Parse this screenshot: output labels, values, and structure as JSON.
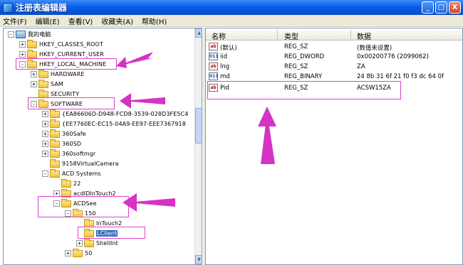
{
  "window": {
    "title": "注册表编辑器",
    "minimize_glyph": "_",
    "maximize_glyph": "□",
    "close_glyph": "X"
  },
  "menu": [
    "文件(F)",
    "编辑(E)",
    "查看(V)",
    "收藏夹(A)",
    "帮助(H)"
  ],
  "tree": [
    {
      "label": "我的电脑",
      "expander": "-",
      "icon": "computer-icon"
    },
    {
      "label": "HKEY_CLASSES_ROOT",
      "expander": "+",
      "icon": "folder-icon"
    },
    {
      "label": "HKEY_CURRENT_USER",
      "expander": "+",
      "icon": "folder-icon"
    },
    {
      "label": "HKEY_LOCAL_MACHINE",
      "expander": "-",
      "icon": "folder-icon"
    },
    {
      "label": "HARDWARE",
      "expander": "+",
      "icon": "folder-icon"
    },
    {
      "label": "SAM",
      "expander": "+",
      "icon": "folder-icon"
    },
    {
      "label": "SECURITY",
      "expander": "",
      "icon": "folder-icon"
    },
    {
      "label": "SOFTWARE",
      "expander": "-",
      "icon": "folder-icon"
    },
    {
      "label": "{EA86606D-D948-FCD8-3539-028D3FE5C4",
      "expander": "+",
      "icon": "folder-icon"
    },
    {
      "label": "{EE7760EC-EC15-04A9-EE97-EEE7367918",
      "expander": "+",
      "icon": "folder-icon"
    },
    {
      "label": "360Safe",
      "expander": "+",
      "icon": "folder-icon"
    },
    {
      "label": "360SD",
      "expander": "+",
      "icon": "folder-icon"
    },
    {
      "label": "360softmgr",
      "expander": "+",
      "icon": "folder-icon"
    },
    {
      "label": "9158VirtualCamera",
      "expander": "",
      "icon": "folder-icon"
    },
    {
      "label": "ACD Systems",
      "expander": "-",
      "icon": "folder-icon"
    },
    {
      "label": "22",
      "expander": "",
      "icon": "folder-icon"
    },
    {
      "label": "acdIDInTouch2",
      "expander": "+",
      "icon": "folder-icon"
    },
    {
      "label": "ACDSee",
      "expander": "-",
      "icon": "folder-icon"
    },
    {
      "label": "150",
      "expander": "-",
      "icon": "folder-icon"
    },
    {
      "label": "InTouch2",
      "expander": "",
      "icon": "folder-icon"
    },
    {
      "label": "LClient",
      "expander": "",
      "icon": "folder-icon",
      "selected": true
    },
    {
      "label": "ShellInt",
      "expander": "+",
      "icon": "folder-icon"
    },
    {
      "label": "50",
      "expander": "+",
      "icon": "folder-icon"
    }
  ],
  "list": {
    "columns": [
      "名称",
      "类型",
      "数据"
    ],
    "rows": [
      {
        "icon": "ab",
        "name": "(默认)",
        "type": "REG_SZ",
        "data": "(数值未设置)"
      },
      {
        "icon": "bin",
        "name": "iid",
        "type": "REG_DWORD",
        "data": "0x00200776 (2099062)"
      },
      {
        "icon": "ab",
        "name": "lng",
        "type": "REG_SZ",
        "data": "ZA"
      },
      {
        "icon": "bin",
        "name": "md",
        "type": "REG_BINARY",
        "data": "24 8b 31 6f 21 f0 f3 dc 64 0f"
      },
      {
        "icon": "ab",
        "name": "Pid",
        "type": "REG_SZ",
        "data": "ACSW15ZA"
      }
    ]
  },
  "colors": {
    "highlight": "#e23fd0",
    "selection": "#316ac5",
    "titlebar": "#0b5ee8"
  }
}
